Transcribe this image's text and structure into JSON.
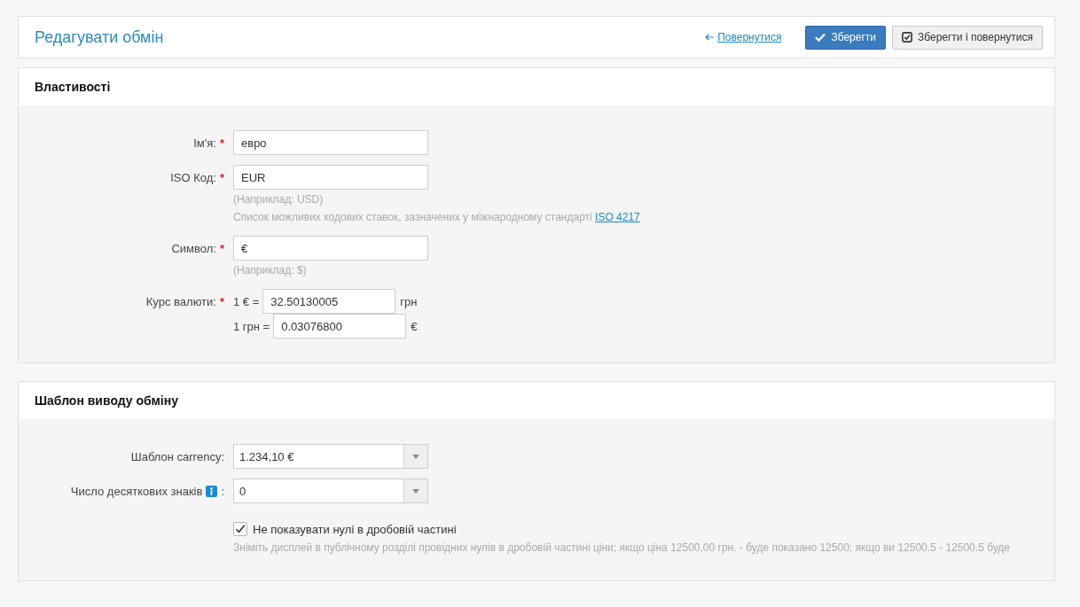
{
  "header": {
    "title": "Редагувати обмін",
    "back_link": "Повернутися",
    "buttons": [
      {
        "label": "Зберегти",
        "kind": "primary"
      },
      {
        "label": "Зберегти і повернутися",
        "kind": "default"
      }
    ]
  },
  "sections": [
    {
      "title": "Властивості",
      "fields": [
        {
          "kind": "text",
          "label": "Ім'я:",
          "required_mark": "*",
          "value": "евро"
        },
        {
          "kind": "text",
          "label": "ISO Код:",
          "required_mark": "*",
          "value": "EUR",
          "hints": [
            {
              "text": "(Наприклад: USD)"
            },
            {
              "text": "Список можливих кодових ставок, зазначених у міжнародному стандарті",
              "link": "ISO 4217"
            }
          ]
        },
        {
          "kind": "text",
          "label": "Символ:",
          "required_mark": "*",
          "value": "€",
          "hints": [
            {
              "text": "(Наприклад: $)"
            }
          ]
        },
        {
          "kind": "rate",
          "label": "Курс валюти:",
          "required_mark": "*",
          "rates": [
            {
              "prefix": "1 € =",
              "value": "32.50130005",
              "suffix": "грн"
            },
            {
              "prefix": "1 грн =",
              "value": "0.03076800",
              "suffix": "€"
            }
          ]
        }
      ]
    },
    {
      "title": "Шаблон виводу обміну",
      "fields": [
        {
          "kind": "select",
          "label": "Шаблон carrency:",
          "value": "1.234,10 €"
        },
        {
          "kind": "select",
          "label": "Число десяткових знаків",
          "info": true,
          "label_suffix": ":",
          "value": "0"
        },
        {
          "kind": "checkbox",
          "checked": true,
          "label": "Не показувати нулі в дробовій частині",
          "hints": [
            {
              "text": "Зніміть дисплей в публічному розділі провідних нулів в дробовій частині ціни; якщо ціна 12500,00 грн. - буде показано 12500; якщо ви 12500.5 - 12500.5 буде"
            }
          ]
        }
      ]
    }
  ]
}
